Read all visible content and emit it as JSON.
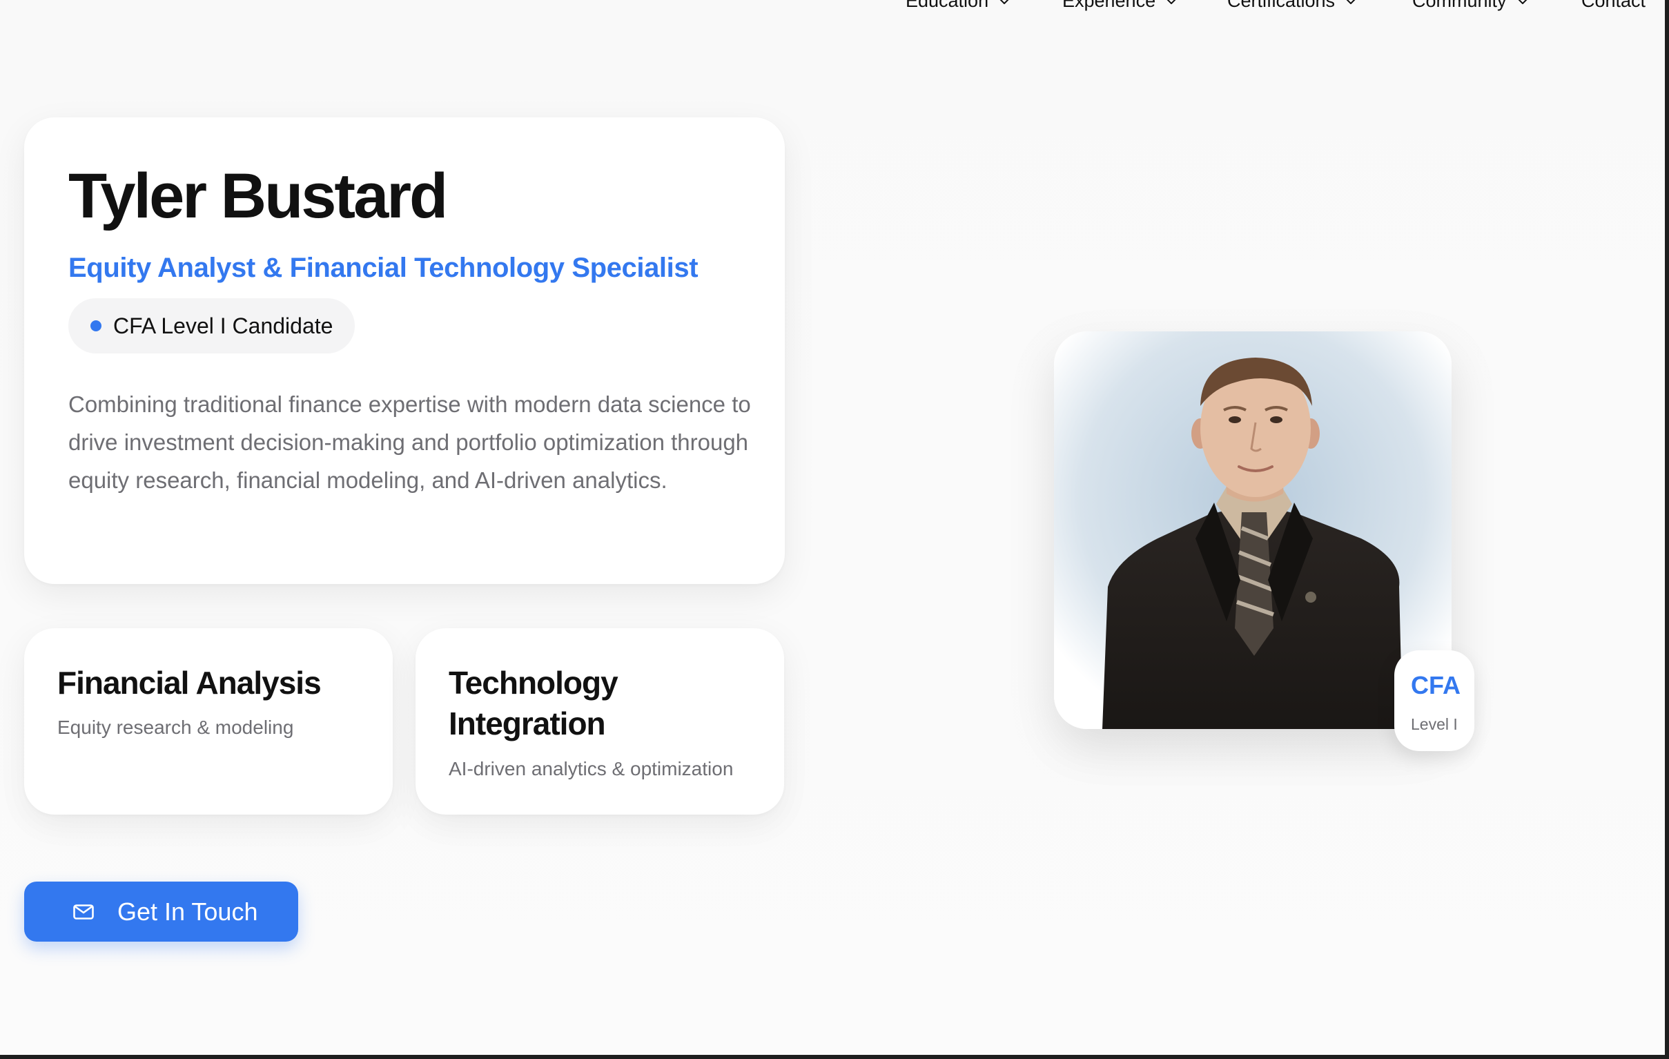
{
  "nav": {
    "items": [
      {
        "label": "Education",
        "has_dropdown": true
      },
      {
        "label": "Experience",
        "has_dropdown": true
      },
      {
        "label": "Certifications",
        "has_dropdown": true
      },
      {
        "label": "Community",
        "has_dropdown": true
      },
      {
        "label": "Contact",
        "has_dropdown": false
      }
    ]
  },
  "hero": {
    "name": "Tyler Bustard",
    "subtitle": "Equity Analyst & Financial Technology Specialist",
    "badge_label": "CFA Level I Candidate",
    "description": "Combining traditional finance expertise with modern data science to drive investment decision-making and portfolio optimization through equity research, financial modeling, and AI-driven analytics."
  },
  "features": [
    {
      "title": "Financial Analysis",
      "subtitle": "Equity research & modeling"
    },
    {
      "title": "Technology Integration",
      "subtitle": "AI-driven analytics & optimization"
    }
  ],
  "cta": {
    "label": "Get In Touch",
    "icon": "mail-icon"
  },
  "profile_badge": {
    "title": "CFA",
    "subtitle": "Level I"
  },
  "colors": {
    "accent": "#3378ef",
    "text": "#111111",
    "muted": "#6e6e73",
    "background": "#f9f9f9"
  }
}
